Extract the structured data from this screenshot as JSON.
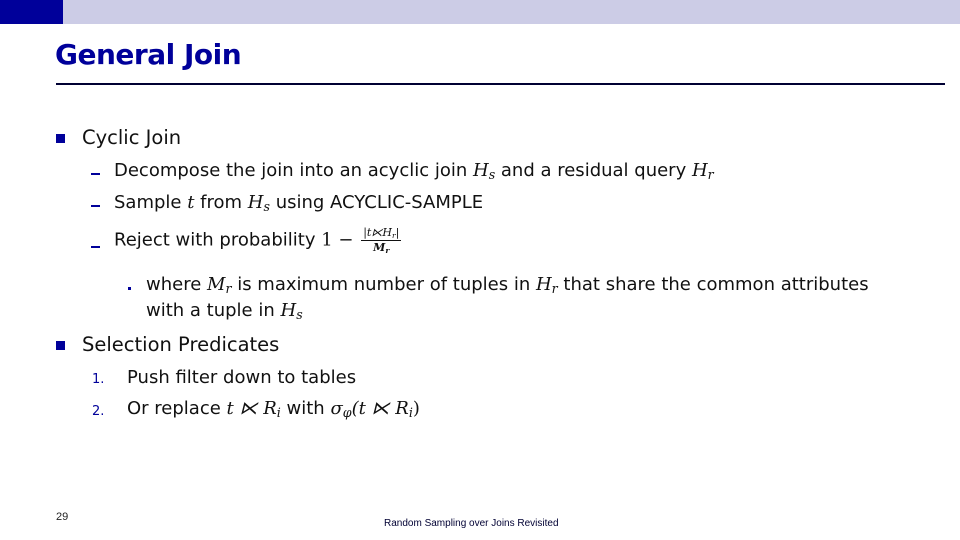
{
  "header": {
    "title": "General Join",
    "colors": {
      "accent_dark": "#00009a",
      "accent_light": "#cccce6"
    }
  },
  "bullets": {
    "cyclic": {
      "label": "Cyclic Join",
      "items": {
        "decompose": {
          "pre": "Decompose the join into an acyclic join ",
          "hs": "H",
          "hs_sub": "s",
          "mid": " and a residual query ",
          "hr": "H",
          "hr_sub": "r"
        },
        "sample": {
          "pre": "Sample ",
          "t": "t",
          "mid": " from ",
          "hs": "H",
          "hs_sub": "s",
          "post": " using ACYCLIC-SAMPLE"
        },
        "reject": {
          "pre": "Reject with probability ",
          "one_minus": "1 −",
          "frac_num": "|t⋉H",
          "frac_num_sub": "r",
          "frac_num_end": "|",
          "frac_den": "M",
          "frac_den_sub": "r"
        },
        "where": {
          "pre": "where ",
          "mr": "M",
          "mr_sub": "r",
          "mid": " is maximum number of tuples in ",
          "hr": "H",
          "hr_sub": "r",
          "post": " that share the common attributes",
          "line2_pre": "with a tuple in ",
          "hs": "H",
          "hs_sub": "s"
        }
      }
    },
    "selection": {
      "label": "Selection Predicates",
      "items": [
        {
          "number": "1.",
          "text": "Push filter down to tables"
        },
        {
          "number": "2.",
          "pre": "Or replace ",
          "expr1": "t ⋉ R",
          "expr1_sub": "i",
          "mid": " with ",
          "sigma": "σ",
          "sigma_sub": "φ",
          "expr2": "(t ⋉ R",
          "expr2_sub": "i",
          "expr2_end": ")"
        }
      ]
    }
  },
  "footer": {
    "page_number": "29",
    "text": "Random Sampling over Joins Revisited"
  }
}
